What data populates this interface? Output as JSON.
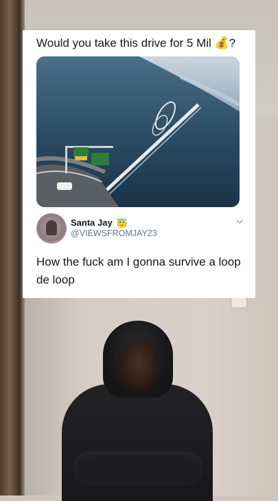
{
  "post": {
    "caption": "Would you take this drive for 5 Mil 💰?",
    "author_name": "Santa Jay",
    "author_badge": "😇",
    "author_handle": "@VIEWSFROMJAY23",
    "text": "How the fuck am I gonna survive a loop de loop"
  },
  "icons": {
    "menu": "chevron-down-icon",
    "badge": "halo-emoji-icon"
  },
  "colors": {
    "card_bg": "#ffffff",
    "text": "#14171a",
    "muted": "#657786",
    "water": "#1f3d55",
    "sign_green": "#2e7d3c"
  }
}
